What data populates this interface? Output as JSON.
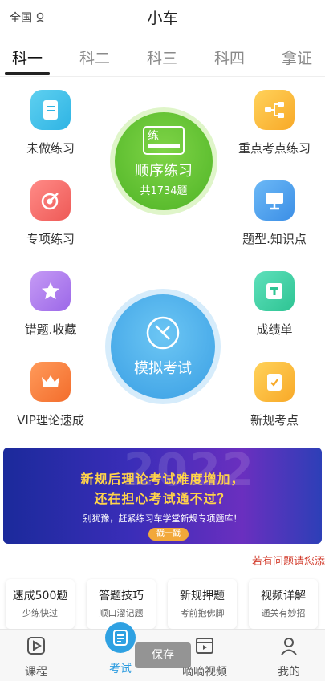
{
  "header": {
    "region": "全国",
    "title": "小车"
  },
  "tabs": [
    "科一",
    "科二",
    "科三",
    "科四",
    "拿证"
  ],
  "features": {
    "not_done": "未做练习",
    "key_points": "重点考点练习",
    "special": "专项练习",
    "question_types": "题型.知识点",
    "wrong_fav": "错题.收藏",
    "scores": "成绩单",
    "vip": "VIP理论速成",
    "new_rules": "新规考点"
  },
  "sequential": {
    "label": "顺序练习",
    "icon_text": "练",
    "count_text": "共1734题"
  },
  "mock_exam": {
    "label": "模拟考试"
  },
  "banner": {
    "year_bg": "2022",
    "line1": "新规后理论考试难度增加，",
    "line2": "还在担心考试通不过？",
    "line3": "别犹豫，赶紧练习车学堂新规专项题库！",
    "button": "戳一戳"
  },
  "feedback_link": "若有问题请您添",
  "cards": [
    {
      "title": "速成500题",
      "subtitle": "少练快过"
    },
    {
      "title": "答题技巧",
      "subtitle": "顺口溜记题"
    },
    {
      "title": "新规押题",
      "subtitle": "考前抱佛脚"
    },
    {
      "title": "视频详解",
      "subtitle": "通关有妙招"
    }
  ],
  "nav": {
    "course": "课程",
    "exam": "考试",
    "video": "嘀嘀视频",
    "mine": "我的"
  },
  "toast": "保存",
  "colors": {
    "accent_blue": "#2f9de0",
    "green": "#4fb426",
    "feedback_red": "#d23a2a"
  }
}
